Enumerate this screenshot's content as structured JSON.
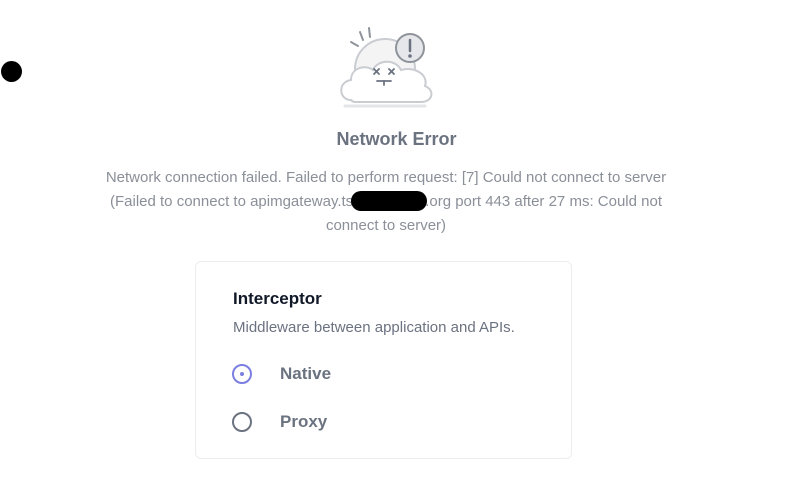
{
  "error": {
    "title": "Network Error",
    "message_part1": "Network connection failed. Failed to perform request: [7] Could not connect to server (Failed to connect to apimgateway.ts",
    "message_part2": ".org port 443 after 27 ms: Could not connect to server)"
  },
  "interceptor": {
    "title": "Interceptor",
    "description": "Middleware between application and APIs.",
    "options": [
      {
        "label": "Native",
        "selected": true
      },
      {
        "label": "Proxy",
        "selected": false
      }
    ]
  },
  "icons": {
    "illustration": "network-error-cloud-icon",
    "radio_checked": "radio-checked-icon",
    "radio_unchecked": "radio-unchecked-icon"
  },
  "colors": {
    "accent": "#7b7fe0",
    "muted_text": "#8a8f98",
    "heading": "#6b7280"
  }
}
